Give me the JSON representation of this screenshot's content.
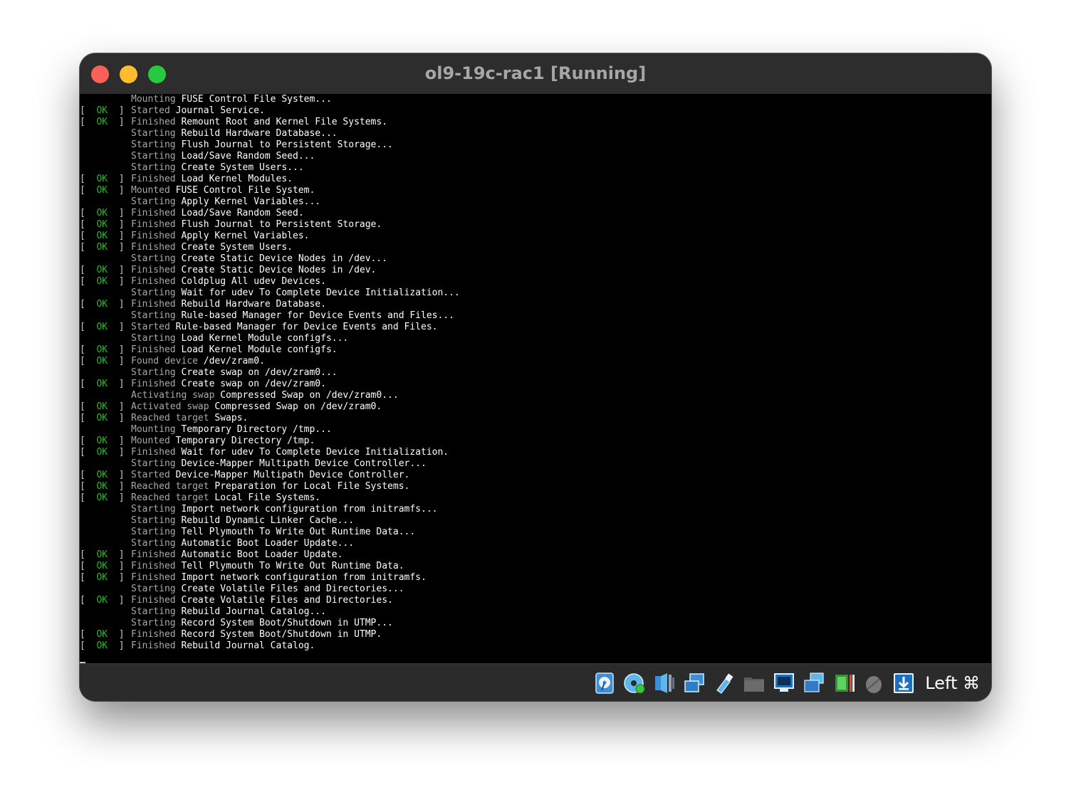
{
  "window": {
    "title": "ol9-19c-rac1 [Running]"
  },
  "console": {
    "lines": [
      {
        "ok": false,
        "verb": "Mounting",
        "text": "FUSE Control File System..."
      },
      {
        "ok": true,
        "verb": "Started",
        "text": "Journal Service."
      },
      {
        "ok": true,
        "verb": "Finished",
        "text": "Remount Root and Kernel File Systems."
      },
      {
        "ok": false,
        "verb": "Starting",
        "text": "Rebuild Hardware Database..."
      },
      {
        "ok": false,
        "verb": "Starting",
        "text": "Flush Journal to Persistent Storage..."
      },
      {
        "ok": false,
        "verb": "Starting",
        "text": "Load/Save Random Seed..."
      },
      {
        "ok": false,
        "verb": "Starting",
        "text": "Create System Users..."
      },
      {
        "ok": true,
        "verb": "Finished",
        "text": "Load Kernel Modules."
      },
      {
        "ok": true,
        "verb": "Mounted",
        "text": "FUSE Control File System."
      },
      {
        "ok": false,
        "verb": "Starting",
        "text": "Apply Kernel Variables..."
      },
      {
        "ok": true,
        "verb": "Finished",
        "text": "Load/Save Random Seed."
      },
      {
        "ok": true,
        "verb": "Finished",
        "text": "Flush Journal to Persistent Storage."
      },
      {
        "ok": true,
        "verb": "Finished",
        "text": "Apply Kernel Variables."
      },
      {
        "ok": true,
        "verb": "Finished",
        "text": "Create System Users."
      },
      {
        "ok": false,
        "verb": "Starting",
        "text": "Create Static Device Nodes in /dev..."
      },
      {
        "ok": true,
        "verb": "Finished",
        "text": "Create Static Device Nodes in /dev."
      },
      {
        "ok": true,
        "verb": "Finished",
        "text": "Coldplug All udev Devices."
      },
      {
        "ok": false,
        "verb": "Starting",
        "text": "Wait for udev To Complete Device Initialization..."
      },
      {
        "ok": true,
        "verb": "Finished",
        "text": "Rebuild Hardware Database."
      },
      {
        "ok": false,
        "verb": "Starting",
        "text": "Rule-based Manager for Device Events and Files..."
      },
      {
        "ok": true,
        "verb": "Started",
        "text": "Rule-based Manager for Device Events and Files."
      },
      {
        "ok": false,
        "verb": "Starting",
        "text": "Load Kernel Module configfs..."
      },
      {
        "ok": true,
        "verb": "Finished",
        "text": "Load Kernel Module configfs."
      },
      {
        "ok": true,
        "verb": "Found device",
        "text": "/dev/zram0."
      },
      {
        "ok": false,
        "verb": "Starting",
        "text": "Create swap on /dev/zram0..."
      },
      {
        "ok": true,
        "verb": "Finished",
        "text": "Create swap on /dev/zram0."
      },
      {
        "ok": false,
        "verb": "Activating swap",
        "text": "Compressed Swap on /dev/zram0..."
      },
      {
        "ok": true,
        "verb": "Activated swap",
        "text": "Compressed Swap on /dev/zram0."
      },
      {
        "ok": true,
        "verb": "Reached target",
        "text": "Swaps."
      },
      {
        "ok": false,
        "verb": "Mounting",
        "text": "Temporary Directory /tmp..."
      },
      {
        "ok": true,
        "verb": "Mounted",
        "text": "Temporary Directory /tmp."
      },
      {
        "ok": true,
        "verb": "Finished",
        "text": "Wait for udev To Complete Device Initialization."
      },
      {
        "ok": false,
        "verb": "Starting",
        "text": "Device-Mapper Multipath Device Controller..."
      },
      {
        "ok": true,
        "verb": "Started",
        "text": "Device-Mapper Multipath Device Controller."
      },
      {
        "ok": true,
        "verb": "Reached target",
        "text": "Preparation for Local File Systems."
      },
      {
        "ok": true,
        "verb": "Reached target",
        "text": "Local File Systems."
      },
      {
        "ok": false,
        "verb": "Starting",
        "text": "Import network configuration from initramfs..."
      },
      {
        "ok": false,
        "verb": "Starting",
        "text": "Rebuild Dynamic Linker Cache..."
      },
      {
        "ok": false,
        "verb": "Starting",
        "text": "Tell Plymouth To Write Out Runtime Data..."
      },
      {
        "ok": false,
        "verb": "Starting",
        "text": "Automatic Boot Loader Update..."
      },
      {
        "ok": true,
        "verb": "Finished",
        "text": "Automatic Boot Loader Update."
      },
      {
        "ok": true,
        "verb": "Finished",
        "text": "Tell Plymouth To Write Out Runtime Data."
      },
      {
        "ok": true,
        "verb": "Finished",
        "text": "Import network configuration from initramfs."
      },
      {
        "ok": false,
        "verb": "Starting",
        "text": "Create Volatile Files and Directories..."
      },
      {
        "ok": true,
        "verb": "Finished",
        "text": "Create Volatile Files and Directories."
      },
      {
        "ok": false,
        "verb": "Starting",
        "text": "Rebuild Journal Catalog..."
      },
      {
        "ok": false,
        "verb": "Starting",
        "text": "Record System Boot/Shutdown in UTMP..."
      },
      {
        "ok": true,
        "verb": "Finished",
        "text": "Record System Boot/Shutdown in UTMP."
      },
      {
        "ok": true,
        "verb": "Finished",
        "text": "Rebuild Journal Catalog."
      }
    ],
    "status_ok": "OK",
    "bracket_open": "[",
    "bracket_close": "]"
  },
  "statusbar": {
    "icons": [
      "hard-disk-icon",
      "optical-drive-icon",
      "audio-icon",
      "network-icon",
      "usb-icon",
      "shared-folders-icon",
      "display-icon",
      "recording-icon",
      "cpu-activity-icon",
      "mouse-integration-icon",
      "keyboard-capture-icon"
    ],
    "host_key": "Left ⌘"
  },
  "colors": {
    "ok_green": "#1fc01f",
    "console_bg": "#000000",
    "titlebar_bg": "#2d2d2d",
    "close": "#fe5f57",
    "minimize": "#febc2e",
    "maximize": "#28c840"
  }
}
